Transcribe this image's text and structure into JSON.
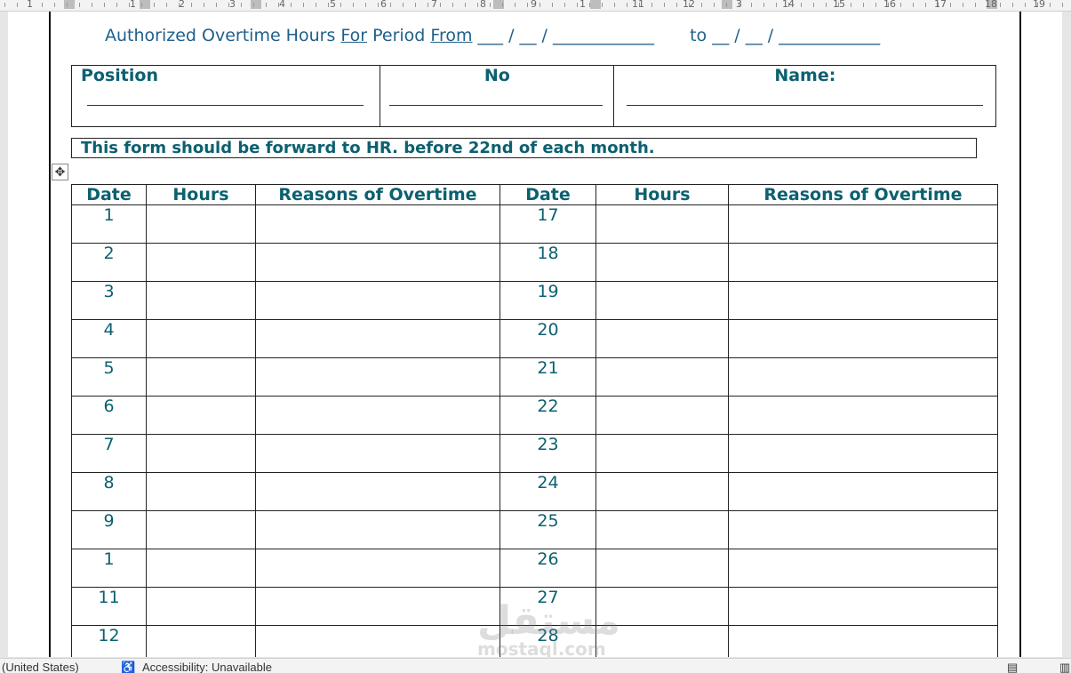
{
  "ruler": {
    "labels": [
      "1",
      "1",
      "2",
      "3",
      "4",
      "5",
      "6",
      "7",
      "8",
      "9",
      "1",
      "11",
      "12",
      "3",
      "14",
      "15",
      "16",
      "17",
      "18",
      "19"
    ]
  },
  "form": {
    "title_prefix": "Authorized Overtime Hours ",
    "title_for": "For",
    "title_period": " Period ",
    "title_from": "From",
    "title_date_from": "___ / __ / ____________",
    "title_to": "to __ / __ / ____________",
    "info": {
      "position_label": "Position",
      "no_label": "No",
      "name_label": "Name:"
    },
    "notice": "This form should be forward to HR. before 22nd of each month.",
    "move_handle_glyph": "✥",
    "table": {
      "headers": [
        "Date",
        "Hours",
        "Reasons of Overtime",
        "Date",
        "Hours",
        "Reasons of Overtime"
      ],
      "left_dates": [
        "1",
        "2",
        "3",
        "4",
        "5",
        "6",
        "7",
        "8",
        "9",
        "1",
        "11",
        "12"
      ],
      "right_dates": [
        "17",
        "18",
        "19",
        "20",
        "21",
        "22",
        "23",
        "24",
        "25",
        "26",
        "27",
        "28"
      ]
    }
  },
  "watermark": {
    "arabic": "مستقل",
    "latin": "mostaql.com"
  },
  "status_bar": {
    "language": "(United States)",
    "accessibility": "Accessibility: Unavailable"
  }
}
